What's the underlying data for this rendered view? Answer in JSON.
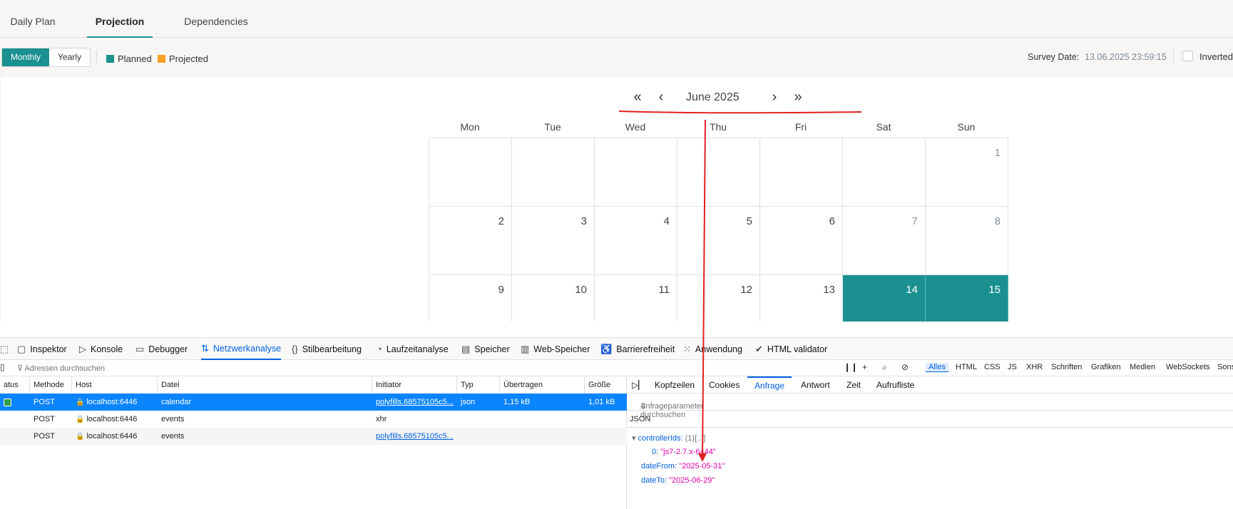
{
  "tabs": [
    "Daily Plan",
    "Projection",
    "Dependencies"
  ],
  "toolbar": {
    "view_modes": [
      "Monthly",
      "Yearly"
    ],
    "legend": [
      {
        "label": "Planned",
        "color": "#1b9090"
      },
      {
        "label": "Projected",
        "color": "#f7a023"
      }
    ],
    "survey_label": "Survey Date:",
    "survey_value": "13.06.2025 23:59:15",
    "inverted_label": "Inverted"
  },
  "calendar": {
    "title": "June 2025",
    "weekdays": [
      "Mon",
      "Tue",
      "Wed",
      "Thu",
      "Fri",
      "Sat",
      "Sun"
    ],
    "weeks": [
      [
        "",
        "",
        "",
        "",
        "",
        "",
        "1"
      ],
      [
        "2",
        "3",
        "4",
        "5",
        "6",
        "7",
        "8"
      ],
      [
        "9",
        "10",
        "11",
        "12",
        "13",
        "14",
        "15"
      ]
    ],
    "planned_days": [
      "14",
      "15"
    ]
  },
  "devtools": {
    "tabs": [
      "Inspektor",
      "Konsole",
      "Debugger",
      "Netzwerkanalyse",
      "Stilbearbeitung",
      "Laufzeitanalyse",
      "Speicher",
      "Web-Speicher",
      "Barrierefreiheit",
      "Anwendung",
      "HTML validator"
    ],
    "filter_placeholder": "Adressen durchsuchen",
    "type_filters": [
      "Alles",
      "HTML",
      "CSS",
      "JS",
      "XHR",
      "Schriften",
      "Grafiken",
      "Medien",
      "WebSockets",
      "Sons"
    ],
    "columns": [
      "atus",
      "Methode",
      "Host",
      "Datei",
      "Initiator",
      "Typ",
      "Übertragen",
      "Größe"
    ],
    "requests": [
      {
        "status": "",
        "method": "POST",
        "host": "localhost:6446",
        "file": "calendar",
        "initiator": "polyfills.68575105c5...",
        "type": "json",
        "transferred": "1,15 kB",
        "size": "1,01 kB"
      },
      {
        "status": "",
        "method": "POST",
        "host": "localhost:6446",
        "file": "events",
        "initiator": "xhr",
        "type": "",
        "transferred": "",
        "size": ""
      },
      {
        "status": "",
        "method": "POST",
        "host": "localhost:6446",
        "file": "events",
        "initiator": "polyfills.68575105c5...",
        "type": "",
        "transferred": "",
        "size": ""
      }
    ],
    "detail_tabs": [
      "Kopfzeilen",
      "Cookies",
      "Anfrage",
      "Antwort",
      "Zeit",
      "Aufrufliste"
    ],
    "param_filter": "Anfrageparameter durchsuchen",
    "json_label": "JSON",
    "payload": {
      "controller_key": "controllerIds:",
      "controller_meta": "(1)[...]",
      "item_key": "0:",
      "item_value": "\"js7-2.7.x-6444\"",
      "date_from_key": "dateFrom:",
      "date_from_value": "\"2025-05-31\"",
      "date_to_key": "dateTo:",
      "date_to_value": "\"2025-06-29\""
    }
  }
}
